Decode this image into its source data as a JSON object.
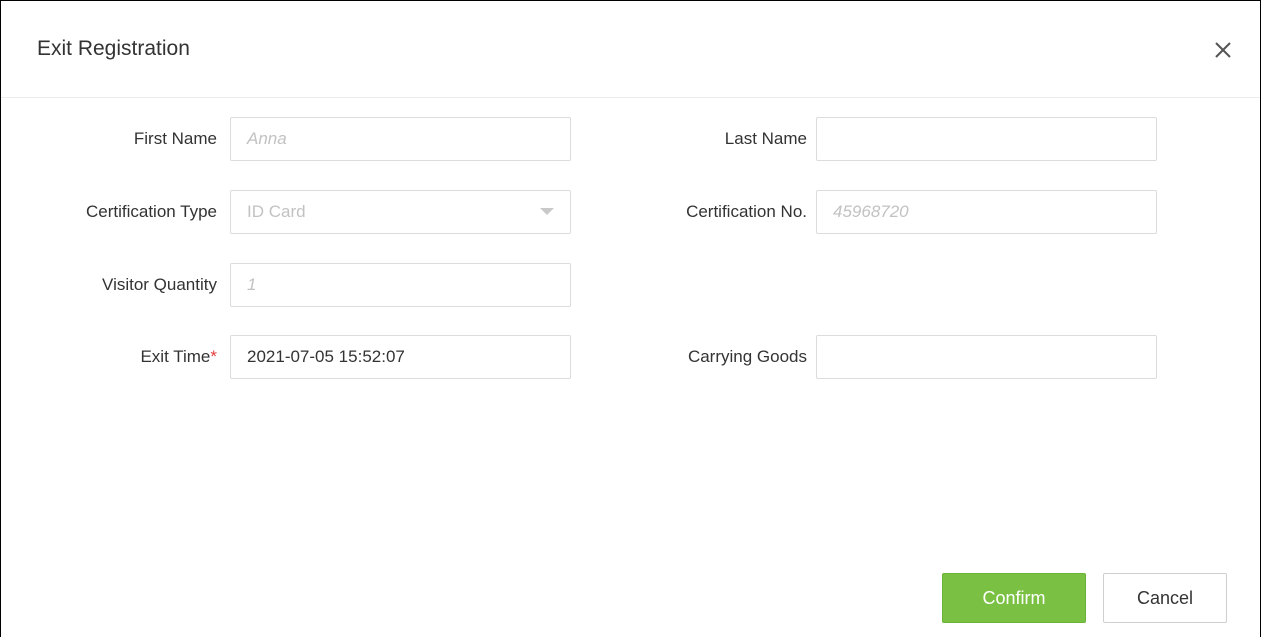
{
  "dialog": {
    "title": "Exit Registration"
  },
  "form": {
    "first_name": {
      "label": "First Name",
      "value": "Anna"
    },
    "last_name": {
      "label": "Last Name",
      "value": ""
    },
    "certification_type": {
      "label": "Certification Type",
      "value": "ID Card"
    },
    "certification_no": {
      "label": "Certification No.",
      "value": "45968720"
    },
    "visitor_quantity": {
      "label": "Visitor Quantity",
      "value": "1"
    },
    "exit_time": {
      "label": "Exit Time",
      "required_mark": "*",
      "value": "2021-07-05 15:52:07"
    },
    "carrying_goods": {
      "label": "Carrying Goods",
      "value": ""
    }
  },
  "buttons": {
    "confirm": "Confirm",
    "cancel": "Cancel"
  },
  "colors": {
    "accent_green": "#7ac143",
    "required_red": "#e23b3b",
    "border": "#dcdcdc"
  },
  "icons": {
    "close": "close-icon",
    "dropdown": "chevron-down-icon"
  }
}
